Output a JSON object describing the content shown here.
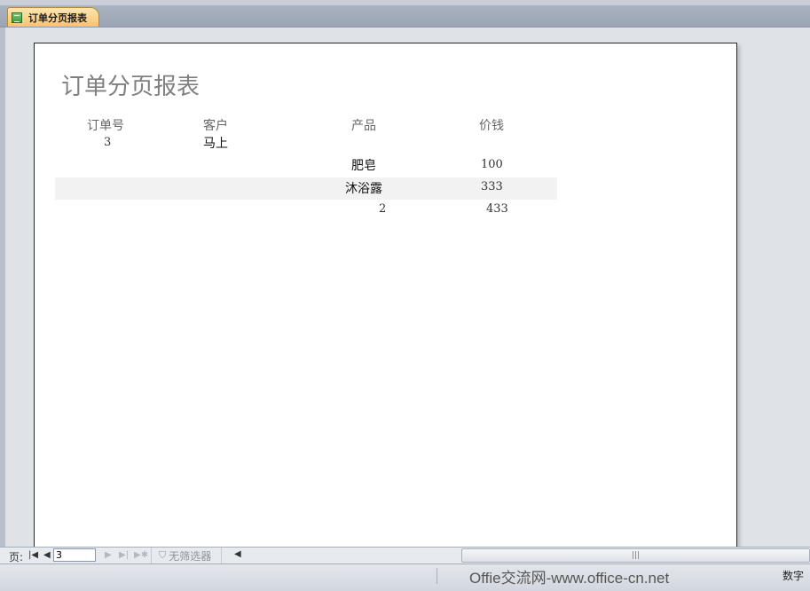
{
  "document_tab": {
    "title": "订单分页报表",
    "icon": "report-icon"
  },
  "report": {
    "title": "订单分页报表",
    "headers": {
      "order_no": "订单号",
      "customer": "客户",
      "product": "产品",
      "price": "价钱"
    },
    "order": {
      "order_no": "3",
      "customer": "马上"
    },
    "items": [
      {
        "product": "肥皂",
        "price": "100"
      },
      {
        "product": "沐浴露",
        "price": "333"
      }
    ],
    "totals": {
      "count": "2",
      "price": "433"
    }
  },
  "navigation": {
    "page_label": "页:",
    "current_page": "3",
    "filter_label": "无筛选器"
  },
  "statusbar": {
    "watermark": "Offie交流网-www.office-cn.net",
    "mode": "数字"
  }
}
